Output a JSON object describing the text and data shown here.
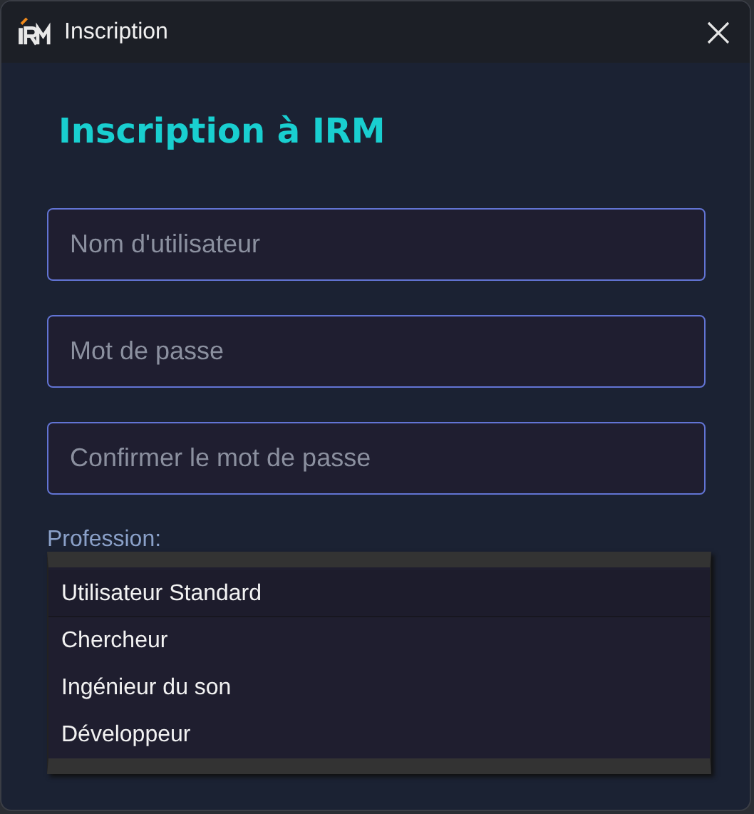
{
  "window": {
    "title": "Inscription"
  },
  "heading": "Inscription à IRM",
  "fields": [
    {
      "placeholder": "Nom d'utilisateur"
    },
    {
      "placeholder": "Mot de passe"
    },
    {
      "placeholder": "Confirmer le mot de passe"
    }
  ],
  "profession": {
    "label": "Profession:",
    "options": [
      {
        "label": "Utilisateur Standard",
        "selected": true
      },
      {
        "label": "Chercheur",
        "selected": false
      },
      {
        "label": "Ingénieur du son",
        "selected": false
      },
      {
        "label": "Développeur",
        "selected": false
      }
    ]
  }
}
